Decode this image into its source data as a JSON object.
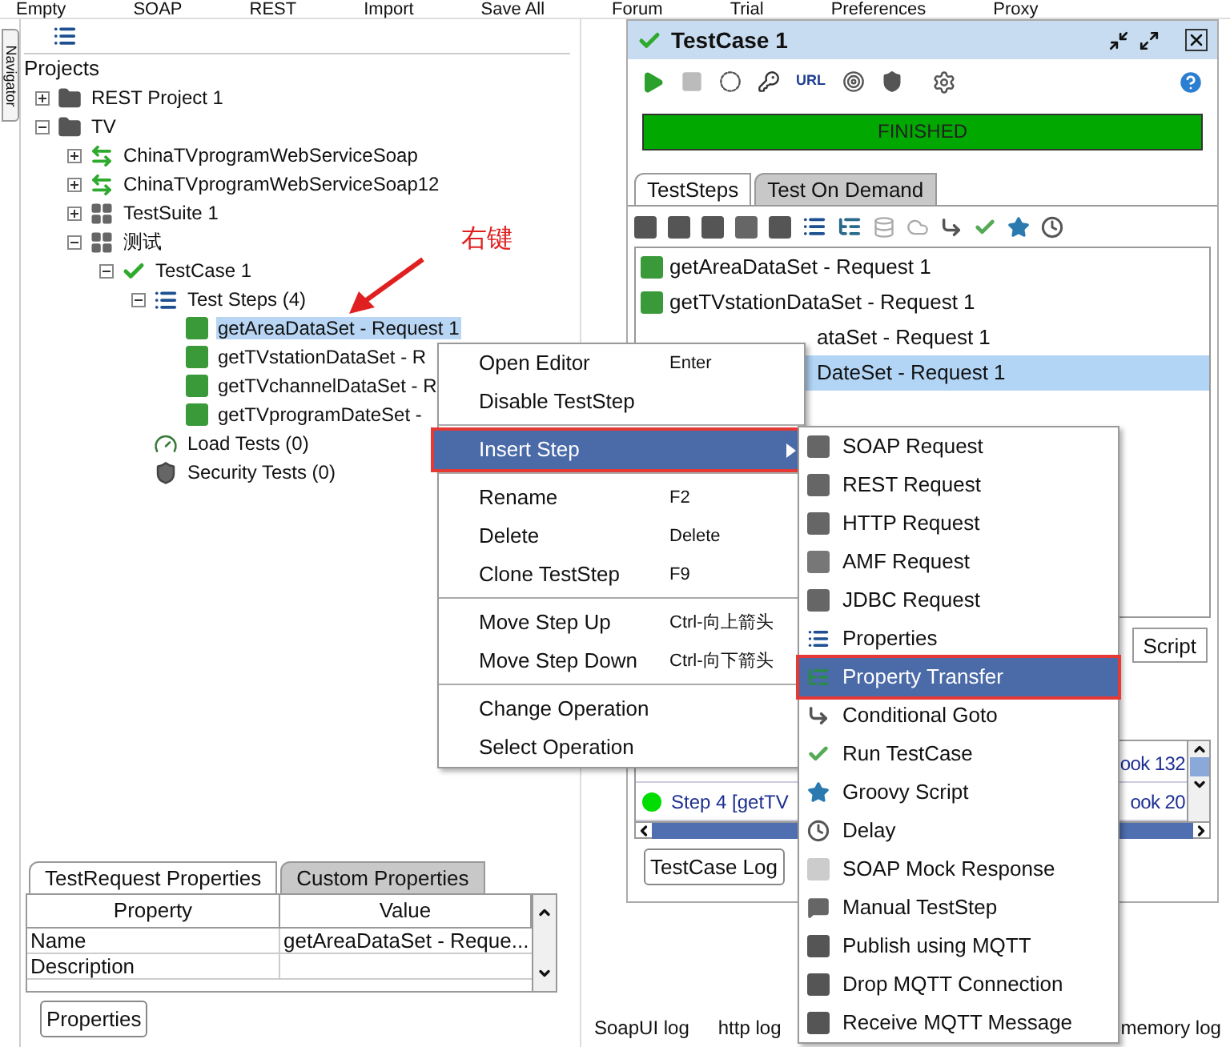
{
  "menu_bar": [
    "Empty",
    "SOAP",
    "REST",
    "Import",
    "Save All",
    "Forum",
    "Trial",
    "Preferences",
    "Proxy"
  ],
  "navigator_tab": "Navigator",
  "tree": {
    "root": "Projects",
    "items": [
      {
        "label": "REST Project 1",
        "kind": "project",
        "expanded": false
      },
      {
        "label": "TV",
        "kind": "project",
        "expanded": true,
        "children": [
          {
            "label": "ChinaTVprogramWebServiceSoap",
            "kind": "interface",
            "expanded": false
          },
          {
            "label": "ChinaTVprogramWebServiceSoap12",
            "kind": "interface",
            "expanded": false
          },
          {
            "label": "TestSuite 1",
            "kind": "suite",
            "expanded": false
          },
          {
            "label": "测试",
            "kind": "suite",
            "expanded": true,
            "children": [
              {
                "label": "TestCase 1",
                "kind": "testcase",
                "expanded": true,
                "children": [
                  {
                    "label": "Test Steps (4)",
                    "kind": "steps",
                    "expanded": true,
                    "children": [
                      {
                        "label": "getAreaDataSet - Request 1",
                        "kind": "request",
                        "selected": true
                      },
                      {
                        "label": "getTVstationDataSet - R",
                        "kind": "request",
                        "selected": false
                      },
                      {
                        "label": "getTVchannelDataSet - R",
                        "kind": "request",
                        "selected": false
                      },
                      {
                        "label": "getTVprogramDateSet -",
                        "kind": "request",
                        "selected": false
                      }
                    ]
                  },
                  {
                    "label": "Load Tests (0)",
                    "kind": "load"
                  },
                  {
                    "label": "Security Tests (0)",
                    "kind": "security"
                  }
                ]
              }
            ]
          }
        ]
      }
    ]
  },
  "annotation": "右键",
  "properties_panel": {
    "tabs": [
      {
        "label": "TestRequest Properties",
        "selected": true
      },
      {
        "label": "Custom Properties",
        "selected": false
      }
    ],
    "columns": [
      "Property",
      "Value"
    ],
    "rows": [
      {
        "property": "Name",
        "value": "getAreaDataSet - Reque..."
      },
      {
        "property": "Description"
      }
    ],
    "button": "Properties"
  },
  "testcase_window": {
    "title": "TestCase 1",
    "toolbar_label": "URL",
    "progress": {
      "label": "FINISHED",
      "level": 1
    },
    "tabs": [
      {
        "label": "TestSteps",
        "selected": true
      },
      {
        "label": "Test On Demand",
        "selected": false
      }
    ],
    "steps": [
      {
        "label": "getAreaDataSet - Request 1",
        "kind": "full",
        "selected": false
      },
      {
        "label": "getTVstationDataSet - Request 1",
        "kind": "full",
        "selected": false
      },
      {
        "label": "ataSet - Request 1",
        "kind": "partial",
        "selected": false
      },
      {
        "label": "DateSet - Request 1",
        "kind": "partial",
        "selected": true
      }
    ],
    "editor_tab": "Script",
    "log_rows": [
      {
        "tail": "ook 132"
      },
      {
        "text": "Step 4 [getTV",
        "color": "#00dd00",
        "tail": "ook 20"
      }
    ],
    "log_button": "TestCase Log"
  },
  "status_bar": [
    "SoapUI log",
    "http log",
    "memory log"
  ],
  "context_menu": [
    [
      {
        "label": "Open Editor",
        "shortcut": "Enter",
        "selected": false
      },
      {
        "label": "Disable TestStep",
        "selected": false
      }
    ],
    [
      {
        "label": "Insert Step",
        "selected": true,
        "submenu": true
      }
    ],
    [
      {
        "label": "Rename",
        "shortcut": "F2",
        "selected": false
      },
      {
        "label": "Delete",
        "shortcut": "Delete",
        "selected": false
      },
      {
        "label": "Clone TestStep",
        "shortcut": "F9",
        "selected": false
      }
    ],
    [
      {
        "label": "Move Step Up",
        "shortcut": "Ctrl-向上箭头",
        "selected": false
      },
      {
        "label": "Move Step Down",
        "shortcut": "Ctrl-向下箭头",
        "selected": false
      }
    ],
    [
      {
        "label": "Change Operation",
        "selected": false
      },
      {
        "label": "Select Operation",
        "selected": false
      }
    ]
  ],
  "submenu": [
    {
      "label": "SOAP Request",
      "selected": false
    },
    {
      "label": "REST Request",
      "selected": false
    },
    {
      "label": "HTTP Request",
      "selected": false
    },
    {
      "label": "AMF Request",
      "selected": false
    },
    {
      "label": "JDBC Request",
      "selected": false
    },
    {
      "label": "Properties",
      "selected": false
    },
    {
      "label": "Property Transfer",
      "selected": true
    },
    {
      "label": "Conditional Goto",
      "selected": false
    },
    {
      "label": "Run TestCase",
      "selected": false
    },
    {
      "label": "Groovy Script",
      "selected": false
    },
    {
      "label": "Delay",
      "selected": false
    },
    {
      "label": "SOAP Mock Response",
      "selected": false
    },
    {
      "label": "Manual TestStep",
      "selected": false
    },
    {
      "label": "Publish using MQTT",
      "selected": false
    },
    {
      "label": "Drop MQTT Connection",
      "selected": false
    },
    {
      "label": "Receive MQTT Message",
      "selected": false
    }
  ]
}
